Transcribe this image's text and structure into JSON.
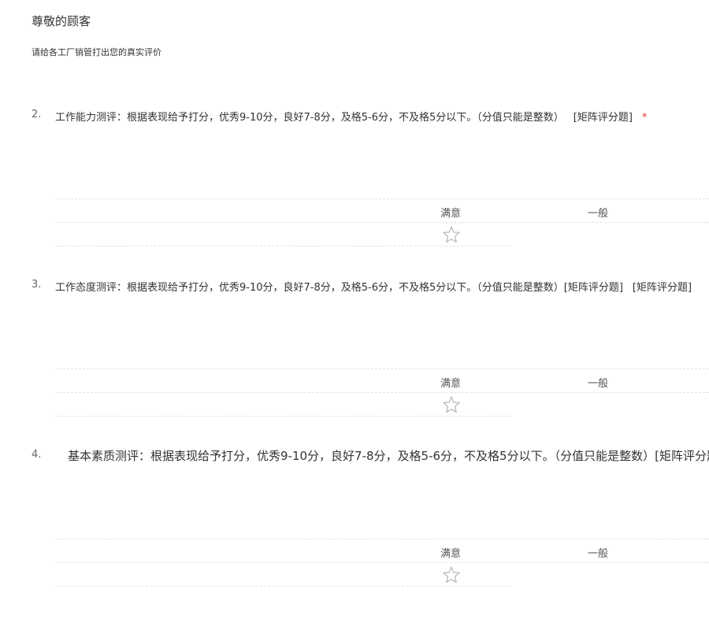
{
  "header": {
    "greeting": "尊敬的顾客",
    "subtitle": "请给各工厂销管打出您的真实评价"
  },
  "questions": [
    {
      "number": "2.",
      "text": "工作能力测评：根据表现给予打分，优秀9-10分，良好7-8分，及格5-6分，不及格5分以下。（分值只能是整数）",
      "tag": "[矩阵评分题]",
      "required_mark": "*",
      "columns": [
        "满意",
        "一般"
      ]
    },
    {
      "number": "3.",
      "text": "工作态度测评：根据表现给予打分，优秀9-10分，良好7-8分，及格5-6分，不及格5分以下。（分值只能是整数）[矩阵评分题]",
      "tag": "[矩阵评分题]",
      "columns": [
        "满意",
        "一般"
      ]
    },
    {
      "number": "4.",
      "text": "基本素质测评：根据表现给予打分，优秀9-10分，良好7-8分，及格5-6分，不及格5分以下。（分值只能是整数）[矩阵评分题]",
      "columns": [
        "满意",
        "一般"
      ]
    }
  ],
  "colors": {
    "required": "#e33333",
    "star_stroke": "#bbbbbb",
    "divider": "#e2e2e2"
  },
  "icons": {
    "rating": "star-outline-icon"
  }
}
